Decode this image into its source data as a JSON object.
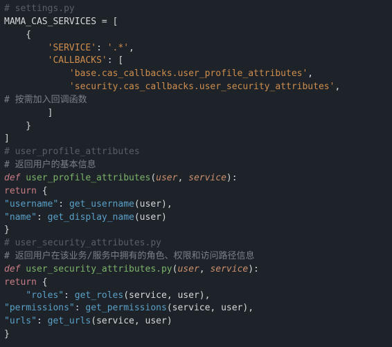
{
  "lines": {
    "l1": "# settings.py",
    "l2a": "MAMA_CAS_SERVICES",
    "l2b": " = [",
    "l3": "    {",
    "l4a": "        ",
    "l4key": "'SERVICE'",
    "l4b": ": ",
    "l4val": "'.*'",
    "l4c": ",",
    "l5a": "        ",
    "l5key": "'CALLBACKS'",
    "l5b": ": [",
    "l6a": "            ",
    "l6s": "'base.cas_callbacks.user_profile_attributes'",
    "l6b": ",",
    "l7a": "            ",
    "l7s": "'security.cas_callbacks.user_security_attributes'",
    "l7b": ",",
    "l8": "# 按需加入回调函数",
    "l9": "        ]",
    "l10": "    }",
    "l11": "]",
    "l12": "# user_profile_attributes",
    "l13": "# 返回用户的基本信息",
    "l14def": "def",
    "l14fn": " user_profile_attributes",
    "l14p1": "(",
    "l14a1": "user",
    "l14cm": ", ",
    "l14a2": "service",
    "l14p2": "):",
    "l15": "return",
    "l15b": " {",
    "l16k": "\"username\"",
    "l16c": ": ",
    "l16f": "get_username",
    "l16p": "(user),",
    "l17k": "\"name\"",
    "l17c": ": ",
    "l17f": "get_display_name",
    "l17p": "(user)",
    "l18": "}",
    "l19": "# user_security_attributes.py",
    "l20": "# 返回用户在该业务/服务中拥有的角色、权限和访问路径信息",
    "l21def": "def",
    "l21fn": " user_security_attributes.py",
    "l21p1": "(",
    "l21a1": "user",
    "l21cm": ", ",
    "l21a2": "service",
    "l21p2": "):",
    "l22": "return",
    "l22b": " {",
    "l23pad": "    ",
    "l23k": "\"roles\"",
    "l23c": ": ",
    "l23f": "get_roles",
    "l23p": "(service, user),",
    "l24k": "\"permissions\"",
    "l24c": ": ",
    "l24f": "get_permissions",
    "l24p": "(service, user),",
    "l25k": "\"urls\"",
    "l25c": ": ",
    "l25f": "get_urls",
    "l25p": "(service, user)",
    "l26": "}"
  }
}
